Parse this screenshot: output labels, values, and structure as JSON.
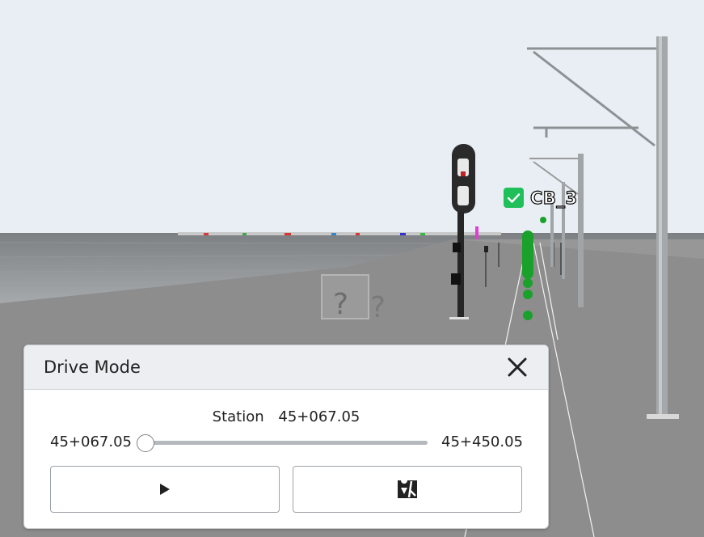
{
  "scene": {
    "signal_label": "CB_3",
    "marker_glyph": "?",
    "colors": {
      "sky": "#e8eef4",
      "ground": "#8c8c8c",
      "signal_green": "#1aa12b",
      "check_green": "#1fbf5a"
    }
  },
  "dialog": {
    "title": "Drive Mode",
    "station_label": "Station",
    "station_value": "45+067.05",
    "range_min": "45+067.05",
    "range_max": "45+450.05",
    "slider_fraction": 0,
    "icons": {
      "close": "close-icon",
      "play": "play-icon",
      "locate": "map-pin-icon"
    }
  }
}
